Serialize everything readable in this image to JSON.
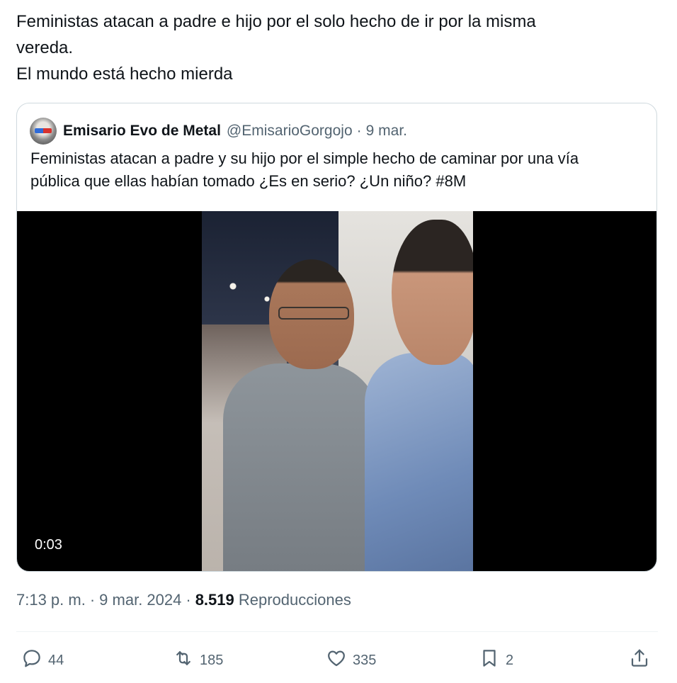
{
  "tweet": {
    "text_lines": [
      "Feministas atacan a padre e hijo por el solo hecho de ir por la misma",
      "vereda.",
      "El mundo está hecho mierda"
    ]
  },
  "quote": {
    "author_name": "Emisario Evo de Metal",
    "author_handle": "@EmisarioGorgojo",
    "separator": "·",
    "date": "9 mar.",
    "text_lines": [
      "Feministas atacan a padre y su hijo por el simple hecho de caminar por una vía",
      "pública que ellas habían tomado ¿Es en serio? ¿Un niño? #8M"
    ],
    "video": {
      "duration": "0:03"
    }
  },
  "meta": {
    "time": "7:13 p. m.",
    "separator": "·",
    "date": "9 mar. 2024",
    "views_count": "8.519",
    "views_label": "Reproducciones"
  },
  "actions": {
    "replies": "44",
    "reposts": "185",
    "likes": "335",
    "bookmarks": "2"
  },
  "colors": {
    "text": "#0f1419",
    "secondary": "#536471",
    "border": "#cfd9de"
  }
}
